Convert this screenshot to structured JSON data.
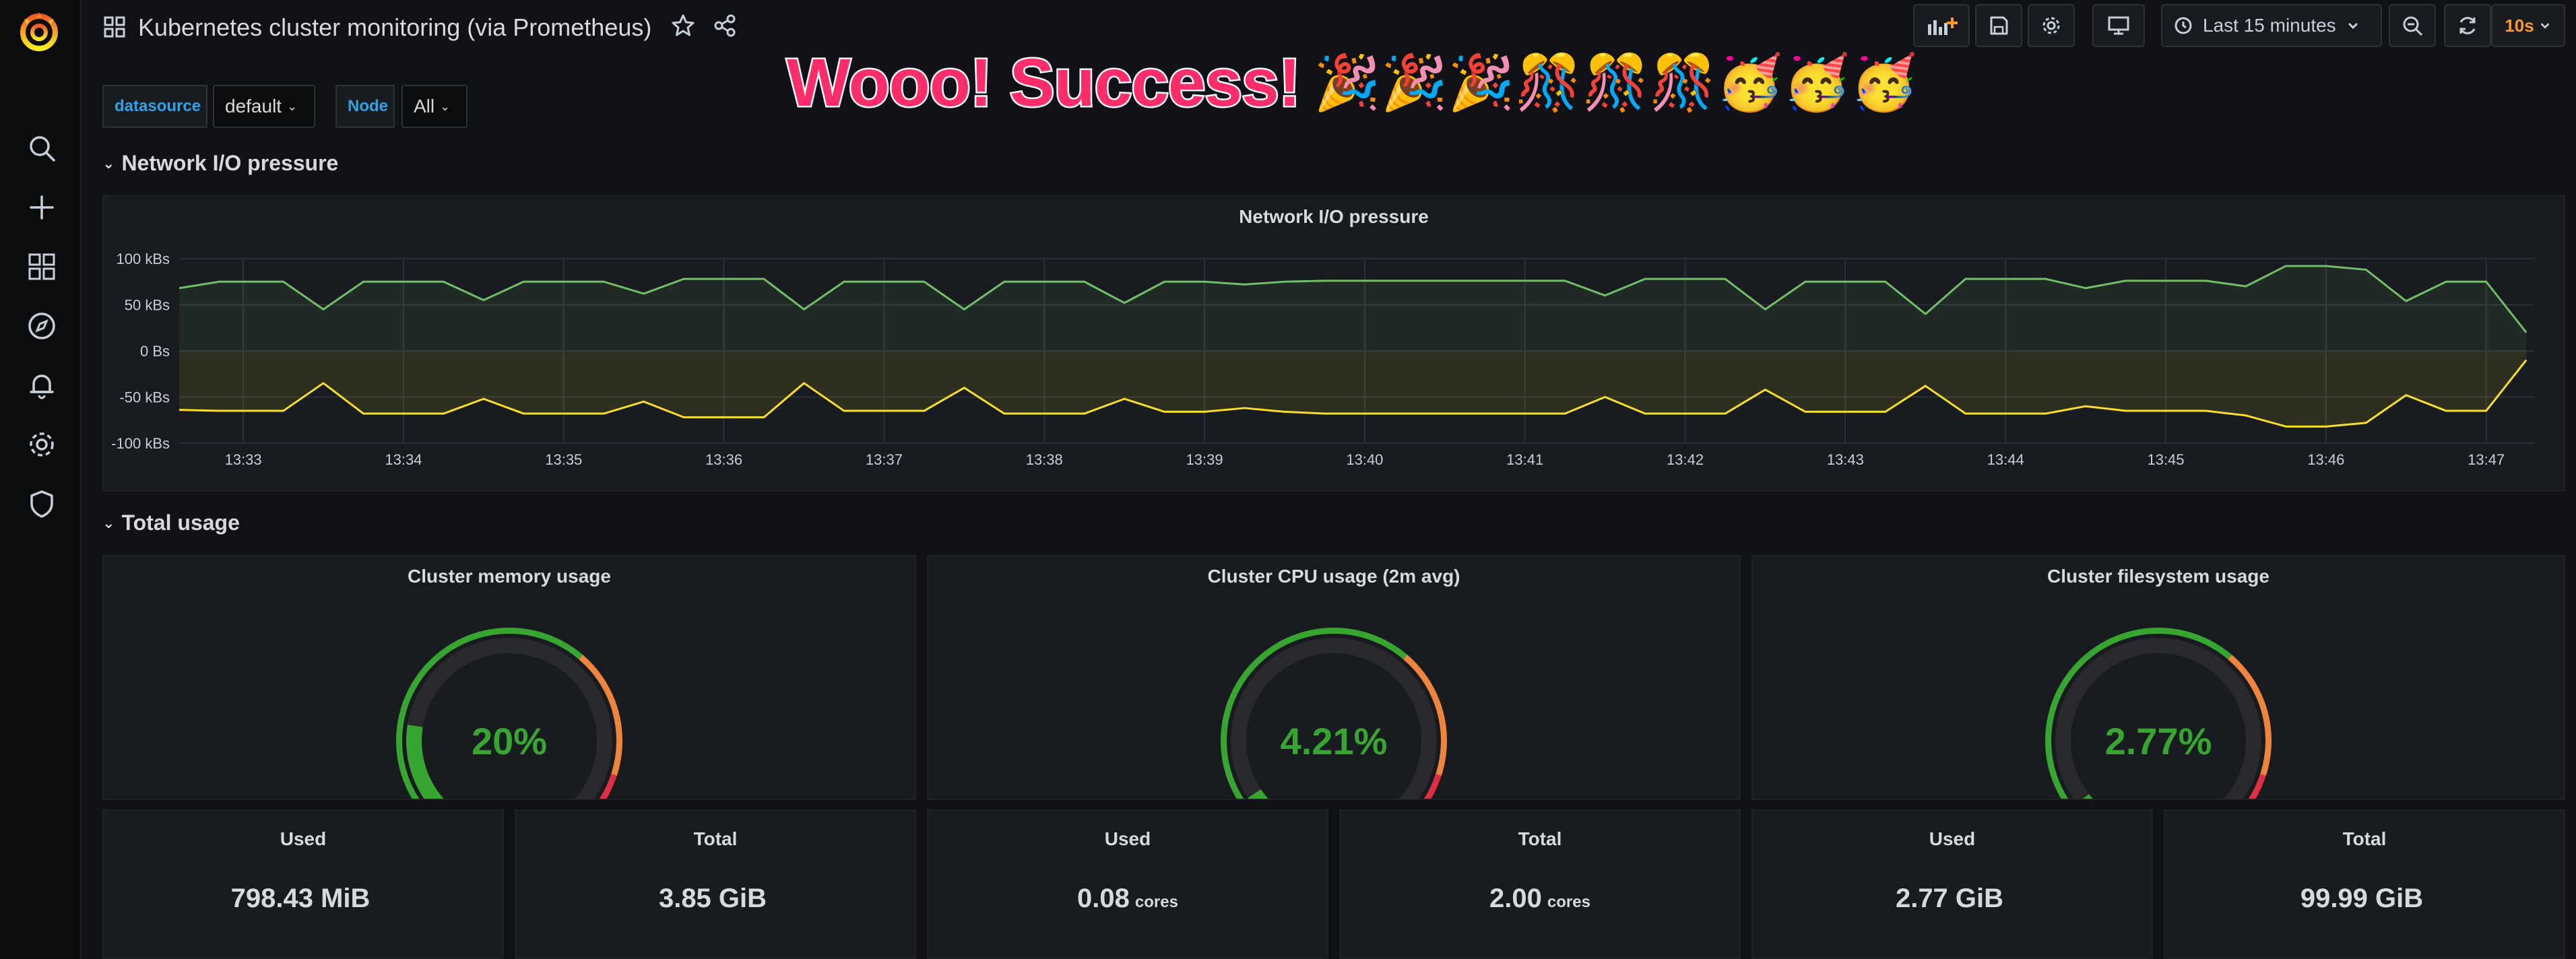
{
  "app": {
    "title": "Kubernetes cluster monitoring (via Prometheus)"
  },
  "toolbar": {
    "time_range": "Last 15 minutes",
    "refresh_interval": "10s"
  },
  "banner": {
    "text": "Wooo! Success!",
    "emoji": "🎉🎉🎉🎊🎊🎊🥳🥳🥳"
  },
  "variables": [
    {
      "label": "datasource",
      "value": "default"
    },
    {
      "label": "Node",
      "value": "All"
    }
  ],
  "rows": {
    "network": "Network I/O pressure",
    "total": "Total usage"
  },
  "network_panel": {
    "title": "Network I/O pressure"
  },
  "chart_data": {
    "type": "line",
    "title": "Network I/O pressure",
    "y_ticks": [
      "100 kBs",
      "50 kBs",
      "0 Bs",
      "-50 kBs",
      "-100 kBs"
    ],
    "ylim": [
      -100,
      100
    ],
    "y_unit": "kBs",
    "x_ticks": [
      "13:33",
      "13:34",
      "13:35",
      "13:36",
      "13:37",
      "13:38",
      "13:39",
      "13:40",
      "13:41",
      "13:42",
      "13:43",
      "13:44",
      "13:45",
      "13:46",
      "13:47"
    ],
    "x_range_minutes": [
      32.6,
      47.3
    ],
    "grid": true,
    "series": [
      {
        "color": "#73bf69",
        "x": [
          32.6,
          32.85,
          33.0,
          33.25,
          33.5,
          33.75,
          34.0,
          34.25,
          34.5,
          34.75,
          35.0,
          35.25,
          35.5,
          35.75,
          36.0,
          36.25,
          36.5,
          36.75,
          37.0,
          37.25,
          37.5,
          37.75,
          38.0,
          38.25,
          38.5,
          38.75,
          39.0,
          39.25,
          39.5,
          39.75,
          40.0,
          40.25,
          40.5,
          40.75,
          41.0,
          41.25,
          41.5,
          41.75,
          42.0,
          42.25,
          42.5,
          42.75,
          43.0,
          43.25,
          43.5,
          43.75,
          44.0,
          44.25,
          44.5,
          44.75,
          45.0,
          45.25,
          45.5,
          45.75,
          46.0,
          46.25,
          46.5,
          46.75,
          47.0,
          47.25
        ],
        "y": [
          68,
          75,
          75,
          75,
          45,
          75,
          75,
          75,
          55,
          75,
          75,
          75,
          62,
          78,
          78,
          78,
          45,
          75,
          75,
          75,
          45,
          75,
          75,
          75,
          52,
          75,
          75,
          72,
          75,
          76,
          76,
          76,
          76,
          76,
          76,
          76,
          60,
          78,
          78,
          78,
          45,
          75,
          75,
          75,
          40,
          78,
          78,
          78,
          68,
          76,
          76,
          76,
          70,
          92,
          92,
          88,
          54,
          75,
          75,
          20
        ]
      },
      {
        "color": "#fade2a",
        "x": [
          32.6,
          32.85,
          33.0,
          33.25,
          33.5,
          33.75,
          34.0,
          34.25,
          34.5,
          34.75,
          35.0,
          35.25,
          35.5,
          35.75,
          36.0,
          36.25,
          36.5,
          36.75,
          37.0,
          37.25,
          37.5,
          37.75,
          38.0,
          38.25,
          38.5,
          38.75,
          39.0,
          39.25,
          39.5,
          39.75,
          40.0,
          40.25,
          40.5,
          40.75,
          41.0,
          41.25,
          41.5,
          41.75,
          42.0,
          42.25,
          42.5,
          42.75,
          43.0,
          43.25,
          43.5,
          43.75,
          44.0,
          44.25,
          44.5,
          44.75,
          45.0,
          45.25,
          45.5,
          45.75,
          46.0,
          46.25,
          46.5,
          46.75,
          47.0,
          47.25
        ],
        "y": [
          -64,
          -65,
          -65,
          -65,
          -35,
          -68,
          -68,
          -68,
          -52,
          -68,
          -68,
          -68,
          -55,
          -72,
          -72,
          -72,
          -35,
          -65,
          -65,
          -65,
          -40,
          -68,
          -68,
          -68,
          -52,
          -66,
          -66,
          -62,
          -66,
          -68,
          -68,
          -68,
          -68,
          -68,
          -68,
          -68,
          -50,
          -68,
          -68,
          -68,
          -42,
          -66,
          -66,
          -66,
          -38,
          -68,
          -68,
          -68,
          -60,
          -65,
          -65,
          -65,
          -70,
          -82,
          -82,
          -78,
          -48,
          -65,
          -65,
          -10
        ]
      }
    ]
  },
  "gauges": [
    {
      "title": "Cluster memory usage",
      "value_text": "20%",
      "fraction": 0.2
    },
    {
      "title": "Cluster CPU usage (2m avg)",
      "value_text": "4.21%",
      "fraction": 0.0421
    },
    {
      "title": "Cluster filesystem usage",
      "value_text": "2.77%",
      "fraction": 0.0277
    }
  ],
  "gauge_thresholds": {
    "green": "#37a630",
    "orange": "#ef843c",
    "red": "#e02f44"
  },
  "stats": [
    {
      "title": "Used",
      "value": "798.43 MiB",
      "unit": ""
    },
    {
      "title": "Total",
      "value": "3.85 GiB",
      "unit": ""
    },
    {
      "title": "Used",
      "value": "0.08",
      "unit": "cores"
    },
    {
      "title": "Total",
      "value": "2.00",
      "unit": "cores"
    },
    {
      "title": "Used",
      "value": "2.77 GiB",
      "unit": ""
    },
    {
      "title": "Total",
      "value": "99.99 GiB",
      "unit": ""
    }
  ]
}
